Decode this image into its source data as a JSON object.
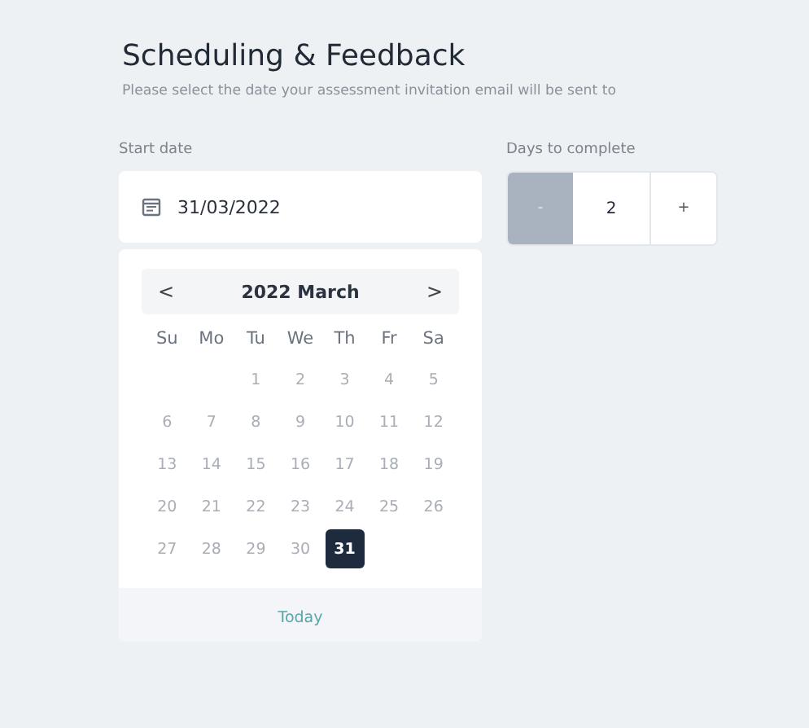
{
  "title": "Scheduling & Feedback",
  "subtitle": "Please select the date your assessment invitation email will be sent to",
  "start_date": {
    "label": "Start date",
    "value": "31/03/2022"
  },
  "days_to_complete": {
    "label": "Days to complete",
    "decrement": {
      "label": "-",
      "disabled": true
    },
    "value": "2",
    "increment": {
      "label": "+",
      "disabled": false
    }
  },
  "calendar": {
    "prev": "<",
    "heading": "2022 March",
    "next": ">",
    "weekdays": [
      "Su",
      "Mo",
      "Tu",
      "We",
      "Th",
      "Fr",
      "Sa"
    ],
    "weeks": [
      {
        "days": [
          {
            "kind": "blank"
          },
          {
            "kind": "blank"
          },
          {
            "label": "1",
            "selected": false,
            "disabled": true
          },
          {
            "label": "2",
            "selected": false,
            "disabled": true
          },
          {
            "label": "3",
            "selected": false,
            "disabled": true
          },
          {
            "label": "4",
            "selected": false,
            "disabled": true
          },
          {
            "label": "5",
            "selected": false,
            "disabled": true
          }
        ]
      },
      {
        "days": [
          {
            "label": "6",
            "selected": false,
            "disabled": true
          },
          {
            "label": "7",
            "selected": false,
            "disabled": true
          },
          {
            "label": "8",
            "selected": false,
            "disabled": true
          },
          {
            "label": "9",
            "selected": false,
            "disabled": true
          },
          {
            "label": "10",
            "selected": false,
            "disabled": true
          },
          {
            "label": "11",
            "selected": false,
            "disabled": true
          },
          {
            "label": "12",
            "selected": false,
            "disabled": true
          }
        ]
      },
      {
        "days": [
          {
            "label": "13",
            "selected": false,
            "disabled": true
          },
          {
            "label": "14",
            "selected": false,
            "disabled": true
          },
          {
            "label": "15",
            "selected": false,
            "disabled": true
          },
          {
            "label": "16",
            "selected": false,
            "disabled": true
          },
          {
            "label": "17",
            "selected": false,
            "disabled": true
          },
          {
            "label": "18",
            "selected": false,
            "disabled": true
          },
          {
            "label": "19",
            "selected": false,
            "disabled": true
          }
        ]
      },
      {
        "days": [
          {
            "label": "20",
            "selected": false,
            "disabled": true
          },
          {
            "label": "21",
            "selected": false,
            "disabled": true
          },
          {
            "label": "22",
            "selected": false,
            "disabled": true
          },
          {
            "label": "23",
            "selected": false,
            "disabled": true
          },
          {
            "label": "24",
            "selected": false,
            "disabled": true
          },
          {
            "label": "25",
            "selected": false,
            "disabled": true
          },
          {
            "label": "26",
            "selected": false,
            "disabled": true
          }
        ]
      },
      {
        "days": [
          {
            "label": "27",
            "selected": false,
            "disabled": true
          },
          {
            "label": "28",
            "selected": false,
            "disabled": true
          },
          {
            "label": "29",
            "selected": false,
            "disabled": true
          },
          {
            "label": "30",
            "selected": false,
            "disabled": true
          },
          {
            "label": "31",
            "selected": true,
            "disabled": false
          }
        ]
      }
    ],
    "today": "Today"
  }
}
